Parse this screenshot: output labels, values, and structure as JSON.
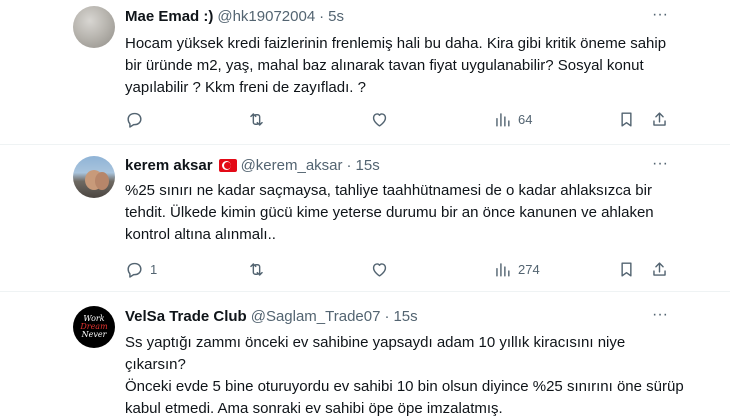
{
  "tweets": [
    {
      "name": "Mae Emad :)",
      "handle": "@hk19072004",
      "dot": "·",
      "time": "5s",
      "body": "Hocam yüksek kredi faizlerinin frenlemiş hali bu daha. Kira gibi kritik öneme sahip bir üründe m2, yaş, mahal baz alınarak tavan fiyat uygulanabilir? Sosyal konut yapılabilir ? Kkm freni de zayıfladı. ?",
      "replies": "",
      "retweets": "",
      "likes": "",
      "views": "64"
    },
    {
      "name": "kerem aksar",
      "handle": "@kerem_aksar",
      "dot": "·",
      "time": "15s",
      "body": "%25 sınırı ne kadar saçmaysa, tahliye taahhütnamesi de o kadar ahlaksızca bir tehdit. Ülkede kimin gücü kime yeterse durumu bir an önce kanunen ve ahlaken kontrol altına alınmalı..",
      "replies": "1",
      "retweets": "",
      "likes": "",
      "views": "274"
    },
    {
      "name": "VelSa Trade Club",
      "handle": "@Saglam_Trade07",
      "dot": "·",
      "time": "15s",
      "body_lines": [
        "Ss yaptığı zammı önceki ev sahibine yapsaydı adam 10 yıllık kiracısını niye çıkarsın?",
        "Önceki evde 5 bine oturuyordu ev sahibi 10 bin olsun diyince %25 sınırını öne sürüp kabul etmedi. Ama sonraki ev sahibi öpe öpe imzalatmış."
      ],
      "avatar_logo": {
        "line1": "Work",
        "line2": "Dream",
        "line3": "Never"
      }
    }
  ],
  "more_label": "···",
  "colors": {
    "text": "#0f1419",
    "secondary": "#536471",
    "divider": "#eff3f4",
    "flag_red": "#e30a17"
  }
}
